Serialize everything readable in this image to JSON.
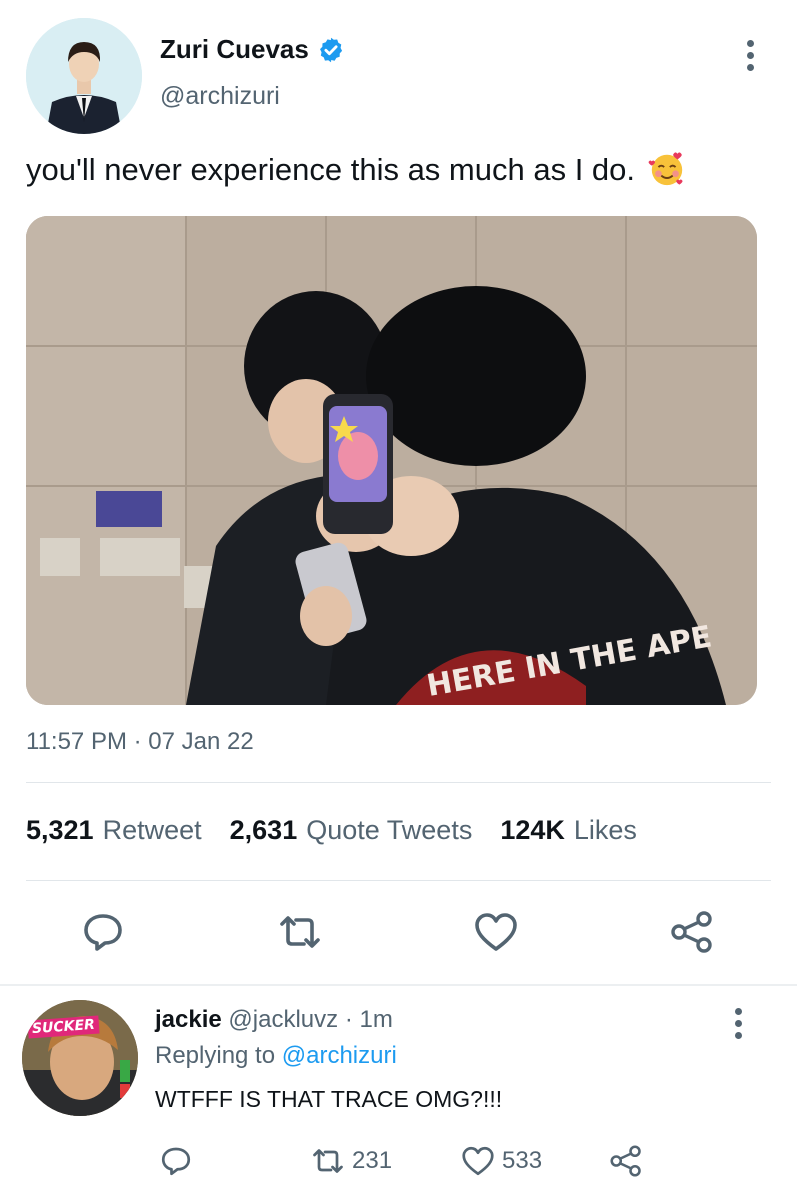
{
  "tweet": {
    "author": {
      "display_name": "Zuri Cuevas",
      "handle": "@archizuri",
      "verified": true
    },
    "text": "you'll never experience this as much as I do.",
    "emoji": "smiling-face-with-hearts",
    "timestamp": "11:57 PM · 07 Jan 22",
    "stats": {
      "retweets": {
        "count": "5,321",
        "label": "Retweet"
      },
      "quotes": {
        "count": "2,631",
        "label": "Quote Tweets"
      },
      "likes": {
        "count": "124K",
        "label": "Likes"
      }
    },
    "actions": [
      "reply-icon",
      "retweet-icon",
      "like-icon",
      "share-icon"
    ]
  },
  "photo": {
    "phone_case_text": "",
    "shirt_print": "HERE IN THE APE"
  },
  "reply": {
    "author": {
      "display_name": "jackie",
      "handle": "@jackluvz",
      "time": "1m"
    },
    "avatar_badge": "SUCKER",
    "replying_prefix": "Replying to",
    "replying_to": "@archizuri",
    "text": "WTFFF IS THAT TRACE OMG?!!!",
    "retweet_count": "231",
    "like_count": "533"
  },
  "colors": {
    "accent": "#1d9bf0",
    "text_primary": "#0f1419",
    "text_secondary": "#536471",
    "divider": "#e1e6ea"
  }
}
